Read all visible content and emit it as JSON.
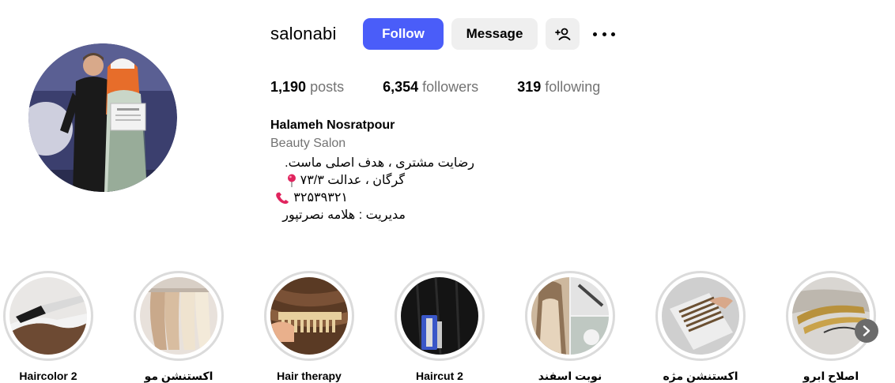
{
  "profile": {
    "username": "salonabi",
    "follow_label": "Follow",
    "message_label": "Message",
    "add_user_icon": "add-person-icon",
    "more_icon": "more-options-icon"
  },
  "stats": {
    "posts_count": "1,190",
    "posts_label": "posts",
    "followers_count": "6,354",
    "followers_label": "followers",
    "following_count": "319",
    "following_label": "following"
  },
  "bio": {
    "name": "Halameh Nosratpour",
    "category": "Beauty Salon",
    "line1": "رضایت مشتری ، هدف اصلی ماست.",
    "line2": "گرگان ، عدالت ۷۳/۳",
    "line2_icon": "location-pin-icon",
    "line3": "۳۲۵۳۹۳۲۱",
    "line3_icon": "telephone-icon",
    "line4": "مدیریت : هلامه نصرتپور"
  },
  "highlights": [
    {
      "label": "Haircolor 2",
      "icon": "hair-dye-brush-image"
    },
    {
      "label": "اکستنشن مو",
      "icon": "hair-extensions-image"
    },
    {
      "label": "Hair therapy",
      "icon": "comb-image"
    },
    {
      "label": "Haircut 2",
      "icon": "dark-hair-clip-image"
    },
    {
      "label": "نوبت اسفند",
      "icon": "collage-image"
    },
    {
      "label": "اکستنشن مژه",
      "icon": "lash-extensions-image"
    },
    {
      "label": "اصلاح ابرو",
      "icon": "brow-tools-image"
    }
  ],
  "navigation": {
    "next_icon": "chevron-right-icon"
  },
  "colors": {
    "follow_button": "#4a5df9",
    "secondary_button": "#efefef",
    "muted_text": "#737373",
    "highlight_ring": "#dbdbdb"
  }
}
